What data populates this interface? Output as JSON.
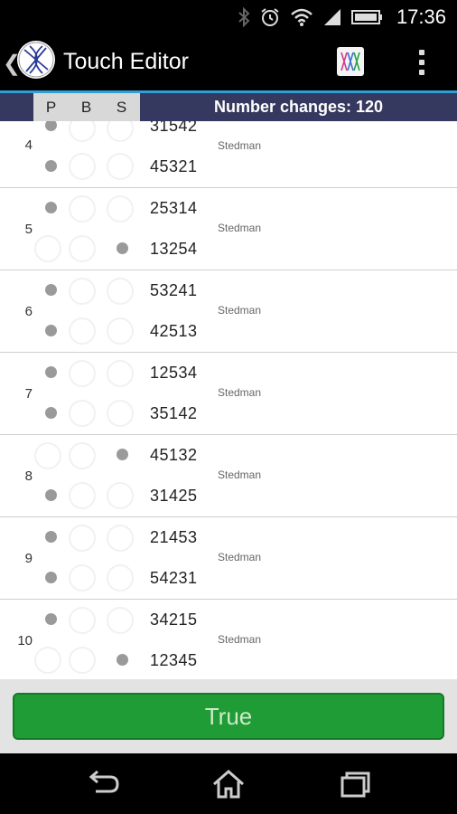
{
  "status_bar": {
    "time": "17:36",
    "icons": [
      "bluetooth-icon",
      "alarm-icon",
      "wifi-icon",
      "signal-icon",
      "battery-icon"
    ]
  },
  "action_bar": {
    "title": "Touch Editor",
    "back_glyph": "❮"
  },
  "header": {
    "columns": [
      "P",
      "B",
      "S"
    ],
    "number_changes": "Number changes: 120"
  },
  "rows": [
    {
      "lead": "4",
      "changes": [
        "31542",
        "45321"
      ],
      "method": "Stedman",
      "marks": [
        "P",
        "P"
      ]
    },
    {
      "lead": "5",
      "changes": [
        "25314",
        "13254"
      ],
      "method": "Stedman",
      "marks": [
        "P",
        "S"
      ]
    },
    {
      "lead": "6",
      "changes": [
        "53241",
        "42513"
      ],
      "method": "Stedman",
      "marks": [
        "P",
        "P"
      ]
    },
    {
      "lead": "7",
      "changes": [
        "12534",
        "35142"
      ],
      "method": "Stedman",
      "marks": [
        "P",
        "P"
      ]
    },
    {
      "lead": "8",
      "changes": [
        "45132",
        "31425"
      ],
      "method": "Stedman",
      "marks": [
        "S",
        "P"
      ]
    },
    {
      "lead": "9",
      "changes": [
        "21453",
        "54231"
      ],
      "method": "Stedman",
      "marks": [
        "P",
        "P"
      ]
    },
    {
      "lead": "10",
      "changes": [
        "34215",
        "12345"
      ],
      "method": "Stedman",
      "marks": [
        "P",
        "S"
      ]
    }
  ],
  "footer": {
    "result_label": "True"
  },
  "colors": {
    "header_bar": "#35385f",
    "accent": "#2f9fd8",
    "true_button": "#1f9c35",
    "dot": "#9a9a9a"
  }
}
